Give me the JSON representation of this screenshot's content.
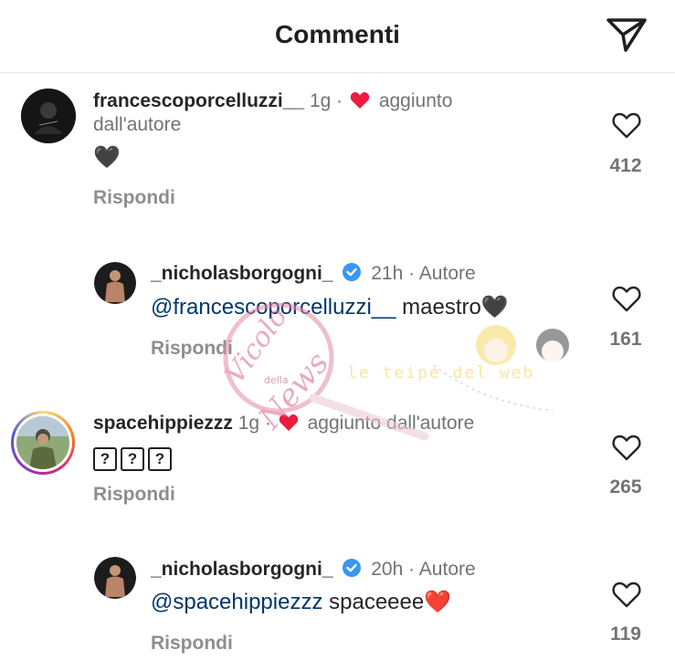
{
  "header": {
    "title": "Commenti",
    "icon": "send-icon"
  },
  "comments": [
    {
      "username": "francescoporcelluzzi__",
      "time": "1g",
      "sep": "·",
      "badge": "aggiunto",
      "badge_cont": "dall'autore",
      "text": "🖤",
      "reply": "Rispondi",
      "likes": "412"
    },
    {
      "username": "_nicholasborgogni_",
      "time": "21h",
      "sep": "·",
      "role": "Autore",
      "mention": "@francescoporcelluzzi__",
      "text": " maestro🖤",
      "reply": "Rispondi",
      "likes": "161"
    },
    {
      "username": "spacehippiezzz",
      "time": "1g",
      "sep": "·",
      "badge": "aggiunto dall'autore",
      "text": [
        "?",
        "?",
        "?"
      ],
      "reply": "Rispondi",
      "likes": "265"
    },
    {
      "username": "_nicholasborgogni_",
      "time": "20h",
      "sep": "·",
      "role": "Autore",
      "mention": "@spacehippiezzz",
      "text": " spaceeee❤️",
      "reply": "Rispondi",
      "likes": "119"
    }
  ],
  "watermark": {
    "text1": "Vicolo",
    "text2": "della",
    "text3": "News",
    "text4": "le teipe del web"
  },
  "colors": {
    "heart_red": "#ed1b3e",
    "verified_blue": "#3897f0",
    "mention_blue": "#00376b",
    "grey": "#737373"
  }
}
